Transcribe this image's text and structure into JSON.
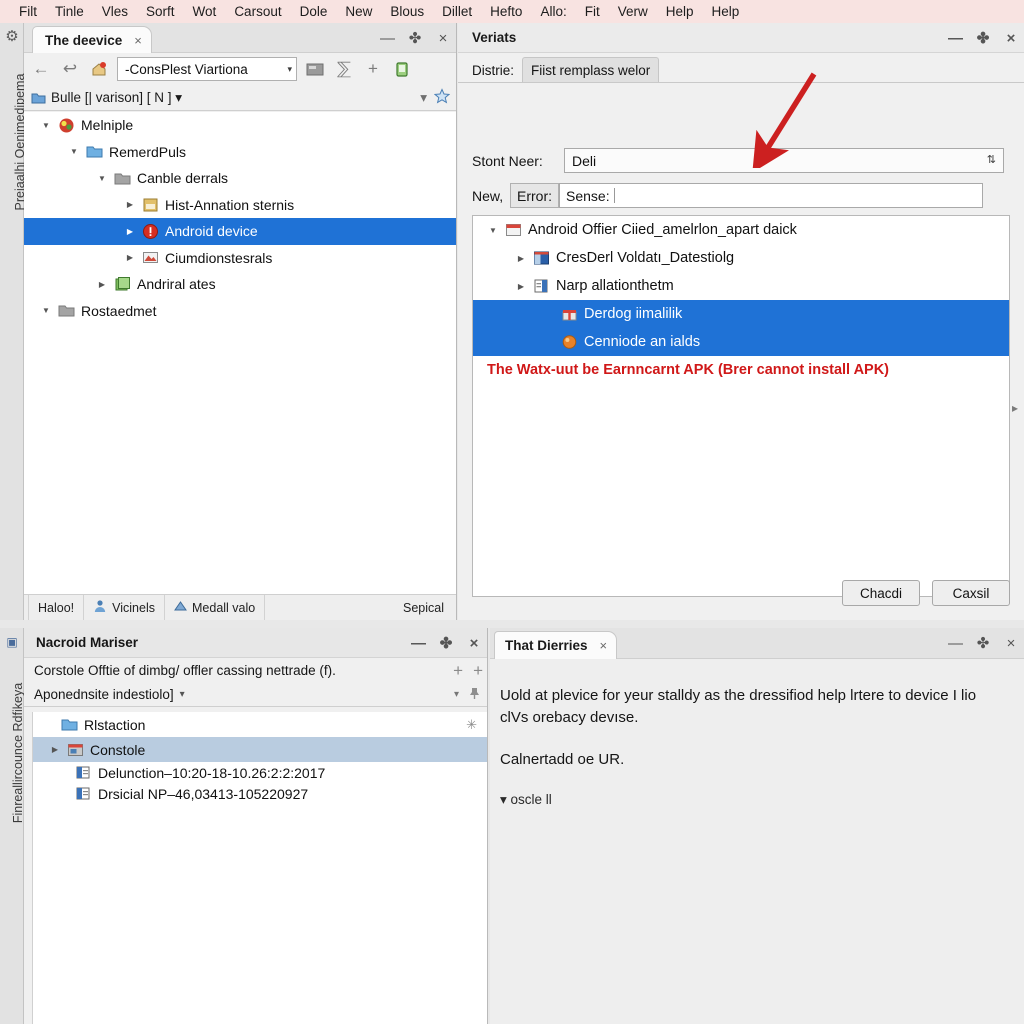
{
  "menubar": {
    "items": [
      {
        "label": "Filt"
      },
      {
        "label": "Tinle"
      },
      {
        "label": "Vles"
      },
      {
        "label": "Sorft"
      },
      {
        "label": "Wot"
      },
      {
        "label": "Carsout"
      },
      {
        "label": "Dole"
      },
      {
        "label": "New"
      },
      {
        "label": "Blous"
      },
      {
        "label": "Dillet"
      },
      {
        "label": "Hefto"
      },
      {
        "label": "Allo:"
      },
      {
        "label": "Fit"
      },
      {
        "label": "Verw"
      },
      {
        "label": "Help"
      },
      {
        "label": "Help"
      }
    ]
  },
  "rail_top": {
    "gear_icon": "gear-icon",
    "vertical_label": "Preiaalhi Oenimedipema"
  },
  "rail_bottom": {
    "pin_icon": "pin-icon",
    "vertical_label": "Finreallircounce Rdfikeya"
  },
  "left_panel": {
    "tab": {
      "title": "The deevice",
      "close": "×"
    },
    "window_buttons": {
      "minimize": "—",
      "maximize": "✤",
      "close": "×"
    },
    "toolbar": {
      "back_icon": "back-arrow-icon",
      "forward_icon": "forward-arrow-icon",
      "home_icon": "home-icon",
      "combo_value": "-ConsPlest Viartiona",
      "combo_arrow": "▾",
      "card_icon": "card-icon",
      "sort_icon": "sort-icon",
      "plus_icon": "plus-icon",
      "device_icon": "device-icon"
    },
    "breadcrumb": {
      "icon": "folder-blue-icon",
      "text": "Bulle [| varison] [ N ] ▾",
      "collapse_arrow": "▾",
      "star_icon": "star-icon"
    },
    "tree": [
      {
        "depth": 0,
        "twisty": "down",
        "icon": "app-icon",
        "label": "Melniple",
        "selected": false
      },
      {
        "depth": 1,
        "twisty": "down",
        "icon": "folder-blue-icon",
        "label": "RemerdPuls",
        "selected": false
      },
      {
        "depth": 2,
        "twisty": "down",
        "icon": "folder-gray-icon",
        "label": "Canble derrals",
        "selected": false
      },
      {
        "depth": 3,
        "twisty": "right",
        "icon": "doc-yellow-icon",
        "label": "Hist-Annation sternis",
        "selected": false
      },
      {
        "depth": 3,
        "twisty": "right",
        "icon": "error-red-icon",
        "label": "Android device",
        "selected": true
      },
      {
        "depth": 3,
        "twisty": "right",
        "icon": "image-icon",
        "label": "Ciumdionstesrals",
        "selected": false
      },
      {
        "depth": 2,
        "twisty": "right",
        "icon": "book-green-icon",
        "label": "Andriral ates",
        "selected": false
      },
      {
        "depth": 1,
        "twisty": "down",
        "icon": "folder-gray-icon",
        "label": "Rostaedmet",
        "selected": false
      }
    ],
    "status": {
      "cell1": "Haloo!",
      "cell2": {
        "icon": "person-icon",
        "label": "Vicinels"
      },
      "cell3": {
        "icon": "triangle-icon",
        "label": "Medall valo"
      },
      "right": "Sepical"
    }
  },
  "dialog": {
    "title": "Veriats",
    "window_buttons": {
      "minimize": "—",
      "maximize": "✤",
      "close": "×"
    },
    "tabs": [
      {
        "label": "Distrie:",
        "active": true
      },
      {
        "label": "Fiist remplass welor",
        "active": false
      }
    ],
    "fields": {
      "store_label": "Stont Neer:",
      "store_value": "Deli",
      "spin_glyph": "⇅",
      "new_label": "New,",
      "error_button": "Error:",
      "sense_label": "Sense:",
      "sense_value": ""
    },
    "list": [
      {
        "depth": 0,
        "twisty": "down",
        "icon": "calendar-icon",
        "label": "Android Offier Ciied_amelrlon_apart daick",
        "selected": false
      },
      {
        "depth": 1,
        "twisty": "right",
        "icon": "window-blue-icon",
        "label": "CresDerl Voldatı_Datestiolg",
        "selected": false
      },
      {
        "depth": 1,
        "twisty": "right",
        "icon": "form-icon",
        "label": "Narp allationthetm",
        "selected": false
      },
      {
        "depth": 2,
        "twisty": "none",
        "icon": "gift-icon",
        "label": "Derdog iimalilik",
        "selected": true
      },
      {
        "depth": 2,
        "twisty": "none",
        "icon": "ball-orange-icon",
        "label": "Cenniode an ialds",
        "selected": true
      }
    ],
    "error_text": "The Watx-uut be Earnncarnt APK (Brer cannot install APK)",
    "buttons": [
      {
        "label": "Chacdi"
      },
      {
        "label": "Caxsil"
      }
    ],
    "arrow_color": "#cc2020",
    "edge_arrow": "▸"
  },
  "bottom_left": {
    "title": "Nacroid Mariser",
    "window_buttons": {
      "minimize": "—",
      "maximize": "✤",
      "close": "×"
    },
    "row1": {
      "text": "Corstole Offtie of dimbg/ offler cassing nettrade (f).",
      "plus1": "+",
      "plus2": "+"
    },
    "row2": {
      "text": "Aponednsite indestiolo]",
      "arrow": "▾",
      "collapse": "▾",
      "pin_icon": "pin-icon"
    },
    "tree": [
      {
        "depth": 0,
        "twisty": "none",
        "icon": "folder-blue-icon",
        "label": "Rlstaction",
        "selected": false,
        "gear": true
      },
      {
        "depth": 0,
        "twisty": "right",
        "icon": "console-icon",
        "label": "Constole",
        "selected": true,
        "gear": false
      },
      {
        "depth": 1,
        "twisty": "none",
        "icon": "file-blue-icon",
        "label": "Delunction–10:20-18-10.26:2:2:2017",
        "selected": false,
        "gear": false
      },
      {
        "depth": 1,
        "twisty": "none",
        "icon": "file-blue-icon",
        "label": "Drsicial NP–46,03413-105220927",
        "selected": false,
        "gear": false
      }
    ]
  },
  "bottom_right": {
    "tab": {
      "title": "That Dierries",
      "close": "×"
    },
    "window_buttons": {
      "minimize": "—",
      "maximize": "✤",
      "close": "×"
    },
    "paragraph1": "Uold at plevice for yeur stalldy as the dressifiod help lrtere to device I lio clVs orebacy devıse.",
    "paragraph2": "Calnertadd oe UR.",
    "paragraph3": "▾ oscle ll"
  },
  "colors": {
    "menubar_bg": "#f8e3e1",
    "selection_blue": "#1f72d6",
    "selection_light": "#b9cce0",
    "error_red": "#d01818",
    "panel_bg": "#f0f0f0"
  }
}
